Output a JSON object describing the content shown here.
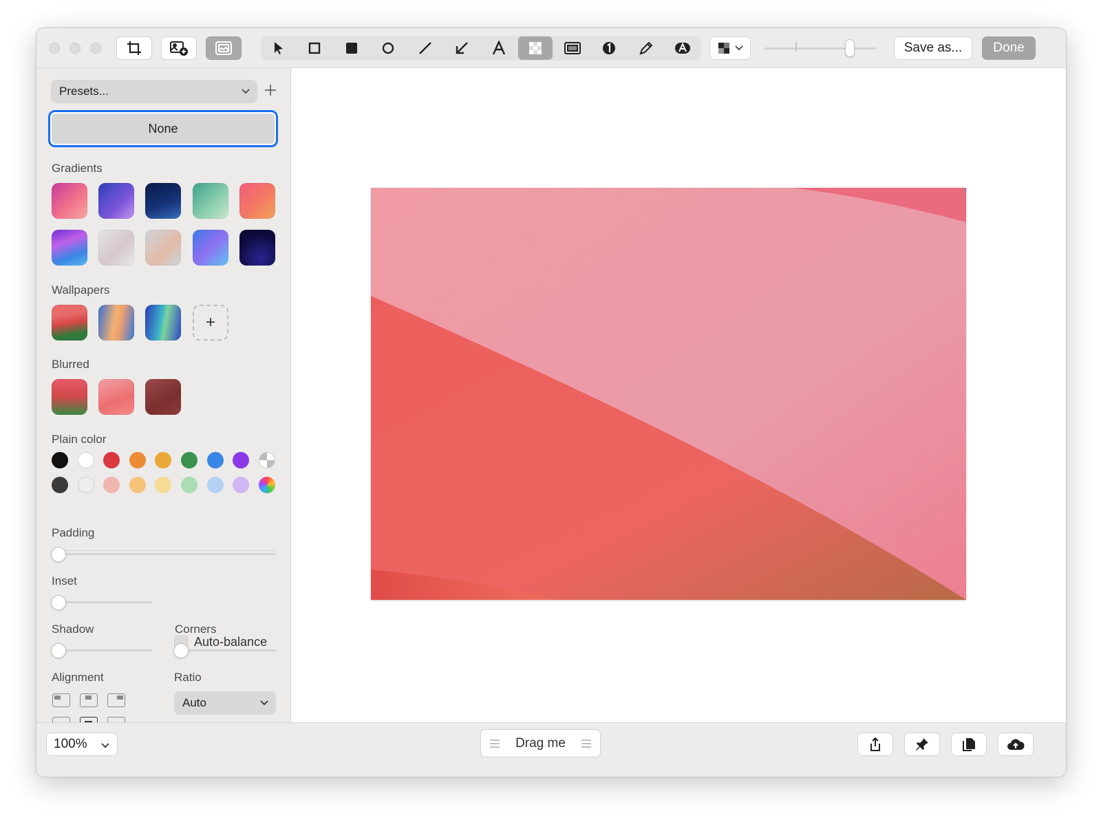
{
  "toolbar": {
    "save_label": "Save as...",
    "done_label": "Done",
    "tools": [
      "crop-icon",
      "add-image-icon",
      "background-icon",
      "pointer-icon",
      "rectangle-outline-icon",
      "rectangle-filled-icon",
      "circle-icon",
      "line-icon",
      "arrow-icon",
      "text-icon",
      "pixelate-icon",
      "highlight-icon",
      "counter-icon",
      "pencil-icon",
      "blur-text-icon",
      "pixel-pattern-icon"
    ],
    "active_tool": "pixelate-icon",
    "zoom_level": 0.75
  },
  "sidebar": {
    "presets_label": "Presets...",
    "none_label": "None",
    "gradients_label": "Gradients",
    "wallpapers_label": "Wallpapers",
    "blurred_label": "Blurred",
    "plain_color_label": "Plain color",
    "padding_label": "Padding",
    "inset_label": "Inset",
    "auto_balance_label": "Auto-balance",
    "shadow_label": "Shadow",
    "corners_label": "Corners",
    "alignment_label": "Alignment",
    "ratio_label": "Ratio",
    "ratio_value": "Auto",
    "padding_value": 0,
    "inset_value": 0,
    "shadow_value": 0,
    "corners_value": 0,
    "auto_balance_checked": false
  },
  "colors": {
    "accent": "#1a6ef0",
    "plain_row1": [
      "#111111",
      "#ffffff",
      "#d9383f",
      "#ec8a35",
      "#eaa836",
      "#3a9150",
      "#3a86e6",
      "#8a39e8"
    ],
    "plain_row2": [
      "#3a3a3a",
      "#eeeeee",
      "#f1b5b0",
      "#f7c27a",
      "#f5db93",
      "#acdcb4",
      "#b3d2f5",
      "#d0b6f3"
    ]
  },
  "bottombar": {
    "zoom": "100%",
    "drag_label": "Drag me",
    "actions": [
      "share-icon",
      "pin-icon",
      "copy-icon",
      "cloud-upload-icon"
    ]
  }
}
